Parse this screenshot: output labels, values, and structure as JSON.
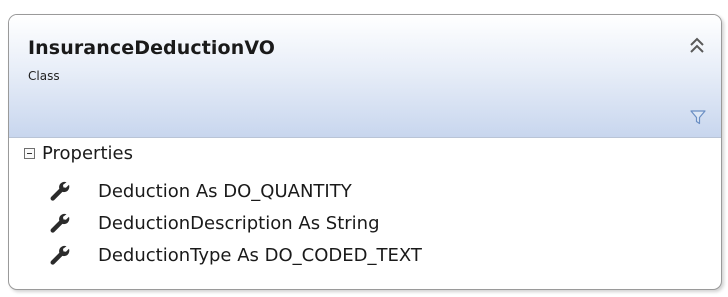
{
  "class": {
    "name": "InsuranceDeductionVO",
    "kind": "Class"
  },
  "icons": {
    "collapse": "double-chevron-up-icon",
    "filter": "filter-funnel-icon",
    "section_toggle": "collapse-minus-icon",
    "member": "wrench-property-icon"
  },
  "colors": {
    "header_gradient_top": "#ffffff",
    "header_gradient_bottom": "#c8d6ee",
    "border": "#9a9a9a",
    "filter_icon": "#6b8fc4"
  },
  "sections": [
    {
      "label": "Properties",
      "members": [
        {
          "text": "Deduction As DO_QUANTITY"
        },
        {
          "text": "DeductionDescription As String"
        },
        {
          "text": "DeductionType As DO_CODED_TEXT"
        }
      ]
    }
  ]
}
